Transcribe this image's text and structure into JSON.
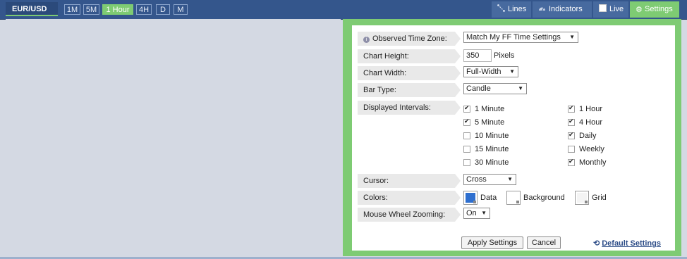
{
  "topbar": {
    "pair": "EUR/USD",
    "timeframes": [
      "1M",
      "5M",
      "1 Hour",
      "4H",
      "D",
      "M"
    ],
    "active_timeframe": "1 Hour",
    "menu": {
      "lines": "Lines",
      "indicators": "Indicators",
      "live": "Live",
      "settings": "Settings"
    }
  },
  "settings": {
    "timezone": {
      "label": "Observed Time Zone:",
      "value": "Match My FF Time Settings"
    },
    "chart_height": {
      "label": "Chart Height:",
      "value": "350",
      "unit": "Pixels"
    },
    "chart_width": {
      "label": "Chart Width:",
      "value": "Full-Width"
    },
    "bar_type": {
      "label": "Bar Type:",
      "value": "Candle"
    },
    "intervals": {
      "label": "Displayed Intervals:",
      "items": [
        {
          "label": "1 Minute",
          "checked": true
        },
        {
          "label": "5 Minute",
          "checked": true
        },
        {
          "label": "10 Minute",
          "checked": false
        },
        {
          "label": "15 Minute",
          "checked": false
        },
        {
          "label": "30 Minute",
          "checked": false
        },
        {
          "label": "1 Hour",
          "checked": true
        },
        {
          "label": "4 Hour",
          "checked": true
        },
        {
          "label": "Daily",
          "checked": true
        },
        {
          "label": "Weekly",
          "checked": false
        },
        {
          "label": "Monthly",
          "checked": true
        }
      ]
    },
    "cursor": {
      "label": "Cursor:",
      "value": "Cross"
    },
    "colors": {
      "label": "Colors:",
      "data": {
        "label": "Data",
        "color": "#2e6fcf"
      },
      "background": {
        "label": "Background",
        "color": "#ffffff"
      },
      "grid": {
        "label": "Grid",
        "color": "#f4f4f4"
      }
    },
    "mouse_wheel": {
      "label": "Mouse Wheel Zooming:",
      "value": "On"
    },
    "apply_label": "Apply Settings",
    "cancel_label": "Cancel",
    "default_label": "Default Settings"
  },
  "colors": {
    "topbar": "#34568c",
    "accent_green": "#7ecb73",
    "chart_bg": "#d4d9e3"
  }
}
